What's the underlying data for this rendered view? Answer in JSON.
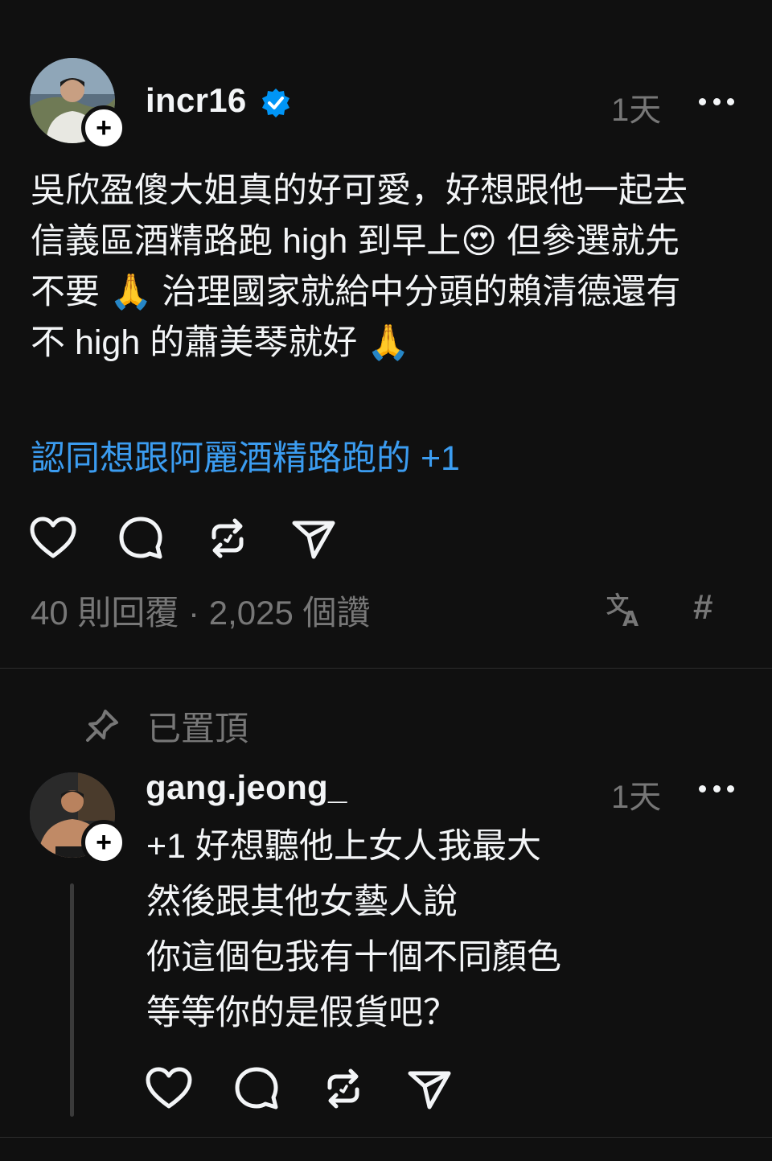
{
  "post": {
    "username": "incr16",
    "time": "1天",
    "lines": [
      "吳欣盈傻大姐真的好可愛，好想跟他一起去",
      "信義區酒精路跑 high 到早上😍 但參選就先",
      "不要 🙏 治理國家就給中分頭的賴清德還有",
      "不 high 的蕭美琴就好 🙏"
    ],
    "tag": "認同想跟阿麗酒精路跑的 +1",
    "stats": "40 則回覆 · 2,025 個讚",
    "hash_symbol": "#"
  },
  "pinned": {
    "label": "已置頂"
  },
  "reply": {
    "username": "gang.jeong_",
    "time": "1天",
    "lines": [
      "+1 好想聽他上女人我最大",
      "然後跟其他女藝人說",
      "你這個包我有十個不同顏色",
      "等等你的是假貨吧？"
    ]
  },
  "colors": {
    "background": "#101010",
    "text": "#f3f5f7",
    "muted": "#777777",
    "link": "#3b9cf0",
    "verified": "#0095f6"
  },
  "icons": [
    "heart-icon",
    "comment-icon",
    "repost-icon",
    "share-icon",
    "translate-icon",
    "hashtag-icon",
    "pin-icon",
    "more-icon",
    "verified-badge-icon"
  ]
}
